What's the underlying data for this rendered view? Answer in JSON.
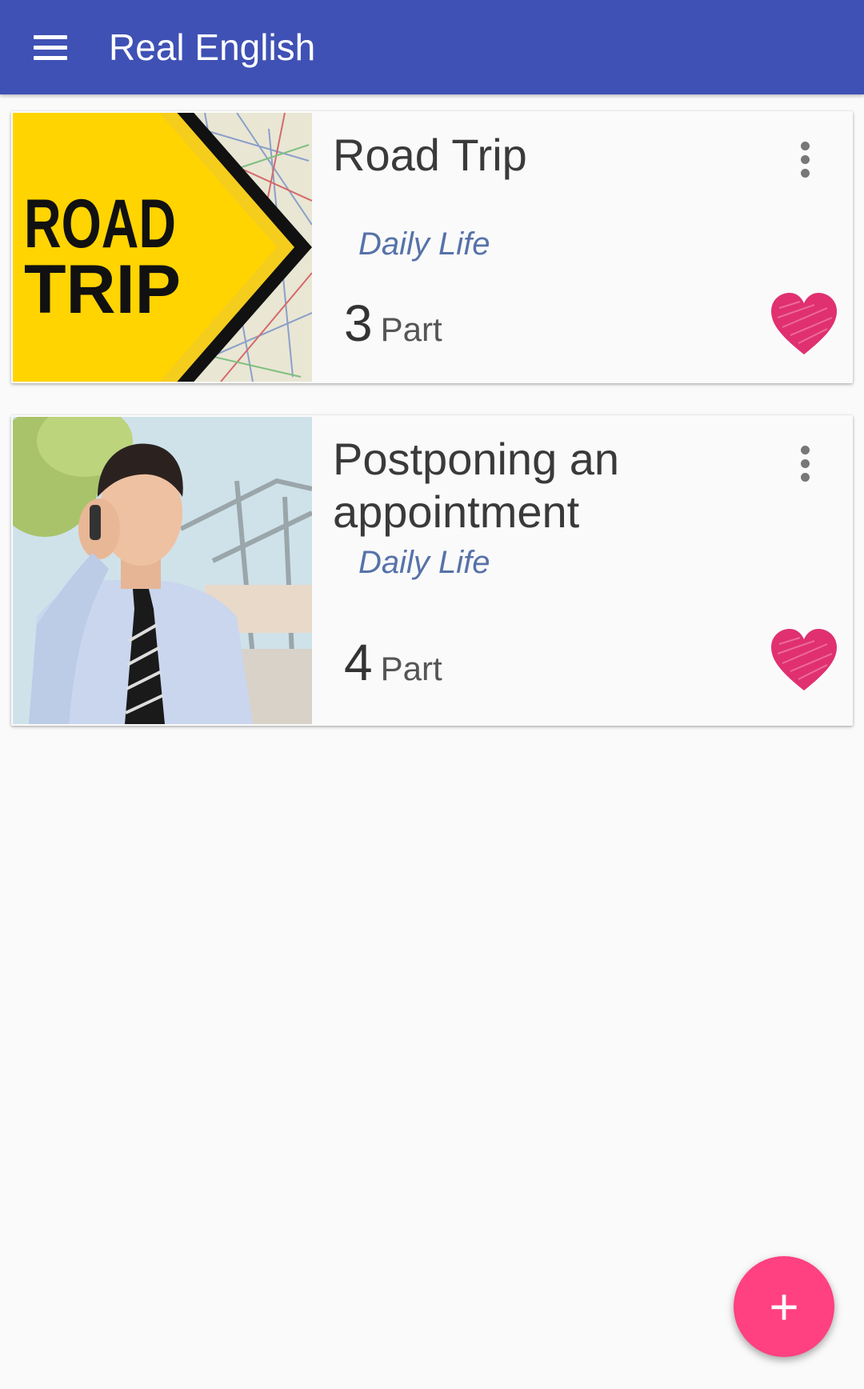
{
  "appbar": {
    "title": "Real English",
    "menu_icon": "hamburger-menu-icon",
    "color": "#3f51b5"
  },
  "lessons": [
    {
      "title": "Road Trip",
      "category": "Daily Life",
      "parts_count": "3",
      "parts_label": "Part",
      "image_text_line1": "ROAD",
      "image_text_line2": "TRIP",
      "image_icon": "road-trip-sign-image",
      "more_icon": "more-vert-icon",
      "favorite_icon": "heart-icon",
      "favorited": true
    },
    {
      "title": "Postponing an appointment",
      "category": "Daily Life",
      "parts_count": "4",
      "parts_label": "Part",
      "image_icon": "businessman-phone-image",
      "more_icon": "more-vert-icon",
      "favorite_icon": "heart-icon",
      "favorited": true
    }
  ],
  "fab": {
    "label": "+",
    "icon": "add-icon",
    "color": "#ff4081"
  },
  "colors": {
    "heart": "#e0306f",
    "category_text": "#5672a8",
    "background": "#fafafa"
  }
}
